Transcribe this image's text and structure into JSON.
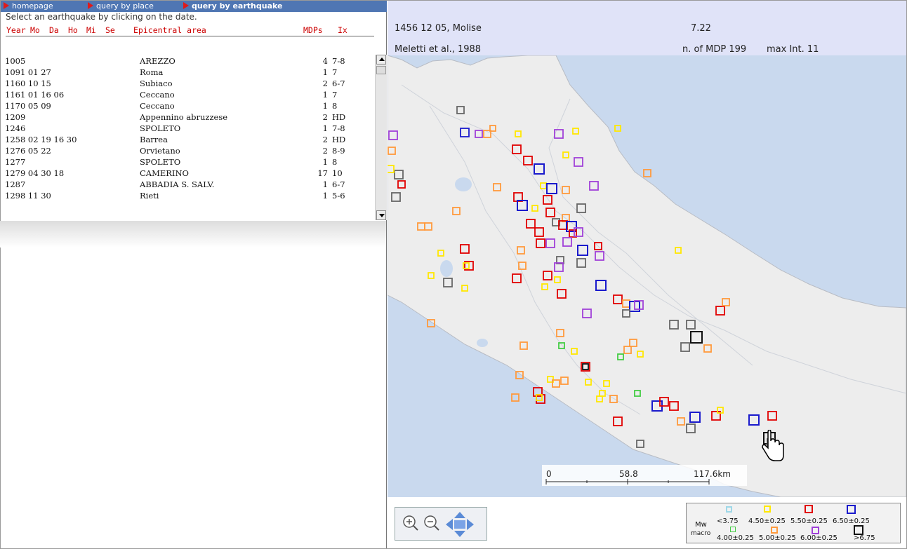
{
  "nav": {
    "items": [
      {
        "label": "homepage"
      },
      {
        "label": "query by place"
      },
      {
        "label": "query by earthquake"
      }
    ]
  },
  "list": {
    "instruction": "Select an earthquake by clicking on the date.",
    "headers": {
      "year": "Year",
      "mo": "Mo",
      "da": "Da",
      "ho": "Ho",
      "mi": "Mi",
      "se": "Se",
      "area": "Epicentral area",
      "mdps": "MDPs",
      "ix": "Ix"
    },
    "rows": [
      {
        "date": "1005",
        "area": "AREZZO",
        "mdps": "4",
        "ix": "7-8"
      },
      {
        "date": "1091 01 27",
        "area": "Roma",
        "mdps": "1",
        "ix": "7"
      },
      {
        "date": "1160 10 15",
        "area": "Subiaco",
        "mdps": "2",
        "ix": "6-7"
      },
      {
        "date": "1161 01 16 06",
        "area": "Ceccano",
        "mdps": "1",
        "ix": "7"
      },
      {
        "date": "1170 05 09",
        "area": "Ceccano",
        "mdps": "1",
        "ix": "8"
      },
      {
        "date": "1209",
        "area": "Appennino abruzzese",
        "mdps": "2",
        "ix": "HD"
      },
      {
        "date": "1246",
        "area": "SPOLETO",
        "mdps": "1",
        "ix": "7-8"
      },
      {
        "date": "1258 02 19 16 30",
        "area": "Barrea",
        "mdps": "2",
        "ix": "HD"
      },
      {
        "date": "1276 05 22",
        "area": "Orvietano",
        "mdps": "2",
        "ix": "8-9"
      },
      {
        "date": "1277",
        "area": "SPOLETO",
        "mdps": "1",
        "ix": "8"
      },
      {
        "date": "1279 04 30 18",
        "area": "CAMERINO",
        "mdps": "17",
        "ix": "10"
      },
      {
        "date": "1287",
        "area": "ABBADIA S. SALV.",
        "mdps": "1",
        "ix": "6-7"
      },
      {
        "date": "1298 11 30",
        "area": "Rieti",
        "mdps": "1",
        "ix": "5-6"
      }
    ]
  },
  "quake": {
    "date": "1456 12 05, Molise",
    "magnitude": "7.22",
    "reference": "Meletti et al., 1988",
    "mdp": "n. of MDP 199",
    "maxint": "max Int. 11"
  },
  "scale": {
    "t0": "0",
    "t1": "58.8",
    "t2": "117.6km"
  },
  "legend": {
    "mw": "Mw",
    "macro": "macro",
    "top_labels": [
      "<3.75",
      "4.50±0.25",
      "5.50±0.25",
      "6.50±0.25"
    ],
    "bottom_labels": [
      "4.00±0.25",
      "5.00±0.25",
      "6.00±0.25",
      ">6.75"
    ],
    "top_colors": [
      "#9fd8e8",
      "#ffe800",
      "#e00000",
      "#1a1acc"
    ],
    "bottom_colors": [
      "#44cc44",
      "#ff9a3c",
      "#a040d8",
      "#111111"
    ]
  },
  "colors": {
    "nav_bg": "#4f76b3",
    "nav_arrow": "#e01a1a",
    "header_red": "#cc0000",
    "sea": "#c9d9ee",
    "land": "#ededed"
  },
  "icons": [
    "zoom-in-icon",
    "zoom-out-icon",
    "pan-arrows-icon",
    "hand-cursor-icon"
  ]
}
